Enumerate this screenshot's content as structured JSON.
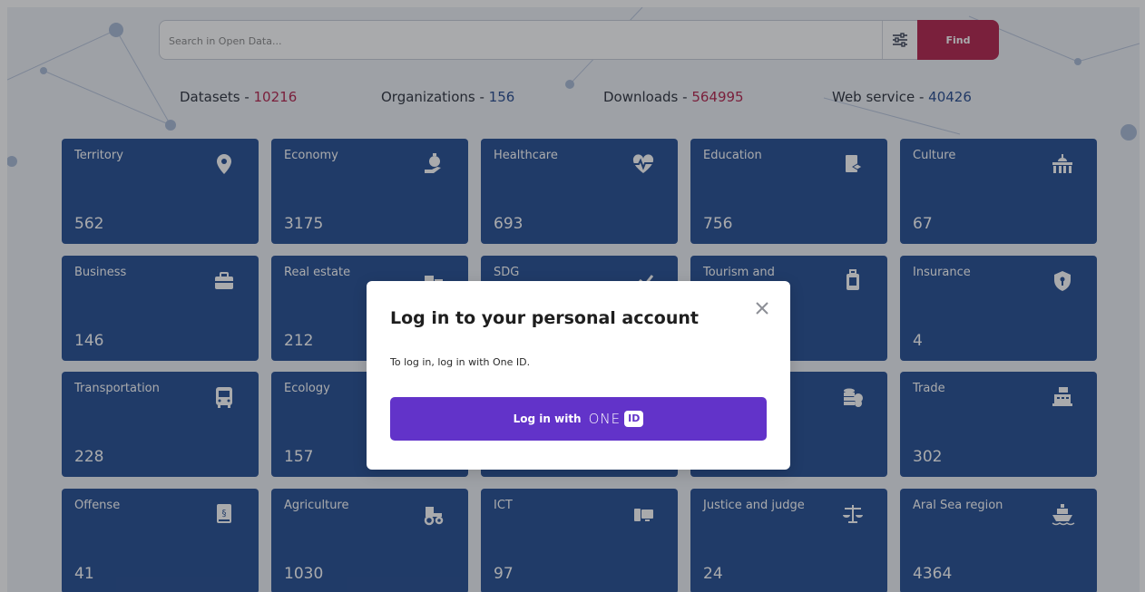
{
  "search": {
    "placeholder": "Search in Open Data...",
    "find_label": "Find"
  },
  "stats": [
    {
      "label": "Datasets - ",
      "value": "10216",
      "color": "#b3214b"
    },
    {
      "label": "Organizations - ",
      "value": "156",
      "color": "#254a8f"
    },
    {
      "label": "Downloads - ",
      "value": "564995",
      "color": "#b3214b"
    },
    {
      "label": "Web service - ",
      "value": "40426",
      "color": "#254a8f"
    }
  ],
  "categories": [
    {
      "title": "Territory",
      "count": "562",
      "icon": "location-pin-icon"
    },
    {
      "title": "Economy",
      "count": "3175",
      "icon": "money-hand-icon"
    },
    {
      "title": "Healthcare",
      "count": "693",
      "icon": "heart-pulse-icon"
    },
    {
      "title": "Education",
      "count": "756",
      "icon": "book-icon"
    },
    {
      "title": "Culture",
      "count": "67",
      "icon": "building-dome-icon"
    },
    {
      "title": "Business",
      "count": "146",
      "icon": "briefcase-icon"
    },
    {
      "title": "Real estate",
      "count": "212",
      "icon": "buildings-icon"
    },
    {
      "title": "SDG",
      "count": "",
      "icon": "chart-icon"
    },
    {
      "title": "Tourism and",
      "count": "",
      "icon": "suitcase-icon"
    },
    {
      "title": "Insurance",
      "count": "4",
      "icon": "shield-icon"
    },
    {
      "title": "Transportation",
      "count": "228",
      "icon": "bus-icon"
    },
    {
      "title": "Ecology",
      "count": "157",
      "icon": "leaf-icon"
    },
    {
      "title": "",
      "count": "",
      "icon": ""
    },
    {
      "title": "",
      "count": "",
      "icon": "coins-icon"
    },
    {
      "title": "Trade",
      "count": "302",
      "icon": "cash-register-icon"
    },
    {
      "title": "Offense",
      "count": "41",
      "icon": "law-book-icon"
    },
    {
      "title": "Agriculture",
      "count": "1030",
      "icon": "tractor-icon"
    },
    {
      "title": "ICT",
      "count": "97",
      "icon": "devices-icon"
    },
    {
      "title": "Justice and judge",
      "count": "24",
      "icon": "scales-icon"
    },
    {
      "title": "Aral Sea region",
      "count": "4364",
      "icon": "ship-icon"
    }
  ],
  "modal": {
    "title": "Log in to your personal account",
    "text": "To log in, log in with One ID.",
    "button_label": "Log in with",
    "oneid_text": "ONE",
    "oneid_badge": "ID"
  },
  "colors": {
    "accent": "#b3214b",
    "tile": "#234c91",
    "login": "#6233c9"
  }
}
